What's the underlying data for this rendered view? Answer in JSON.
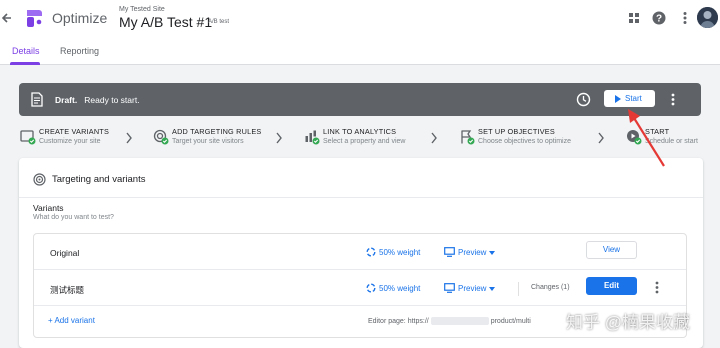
{
  "header": {
    "product_name": "Optimize",
    "site_label": "My Tested Site",
    "experiment_title": "My A/B Test #1",
    "experiment_type": "A/B test",
    "icons": [
      "back-arrow-icon",
      "optimize-logo",
      "apps-grid-icon",
      "help-icon",
      "more-vert-icon",
      "avatar"
    ]
  },
  "tabs": [
    {
      "label": "Details",
      "active": true
    },
    {
      "label": "Reporting",
      "active": false
    }
  ],
  "status": {
    "state": "Draft.",
    "message": "Ready to start.",
    "start_label": "Start",
    "bar_color": "#5f6368"
  },
  "steps": [
    {
      "title": "CREATE VARIANTS",
      "subtitle": "Customize your site",
      "icon": "create-variants-icon"
    },
    {
      "title": "ADD TARGETING RULES",
      "subtitle": "Target your site visitors",
      "icon": "targeting-icon"
    },
    {
      "title": "LINK TO ANALYTICS",
      "subtitle": "Select a property and view",
      "icon": "analytics-icon"
    },
    {
      "title": "SET UP OBJECTIVES",
      "subtitle": "Choose objectives to optimize",
      "icon": "objectives-icon"
    },
    {
      "title": "START",
      "subtitle": "Schedule or start",
      "icon": "start-icon"
    }
  ],
  "card": {
    "title": "Targeting and variants",
    "variants_heading": "Variants",
    "variants_subtitle": "What do you want to test?",
    "variants": [
      {
        "name": "Original",
        "weight": "50% weight",
        "preview": "Preview",
        "action": "View"
      },
      {
        "name": "测试标题",
        "weight": "50% weight",
        "preview": "Preview",
        "changes": "Changes (1)",
        "action": "Edit"
      }
    ],
    "add_variant": "+ Add variant",
    "editor_page_prefix": "Editor page: https://",
    "editor_page_suffix": "product/multi"
  },
  "watermark": "知乎 @楠果收藏",
  "colors": {
    "accent": "#1a73e8",
    "brand": "#7b3fe4",
    "success": "#34a853",
    "annotation": "#e53935"
  }
}
